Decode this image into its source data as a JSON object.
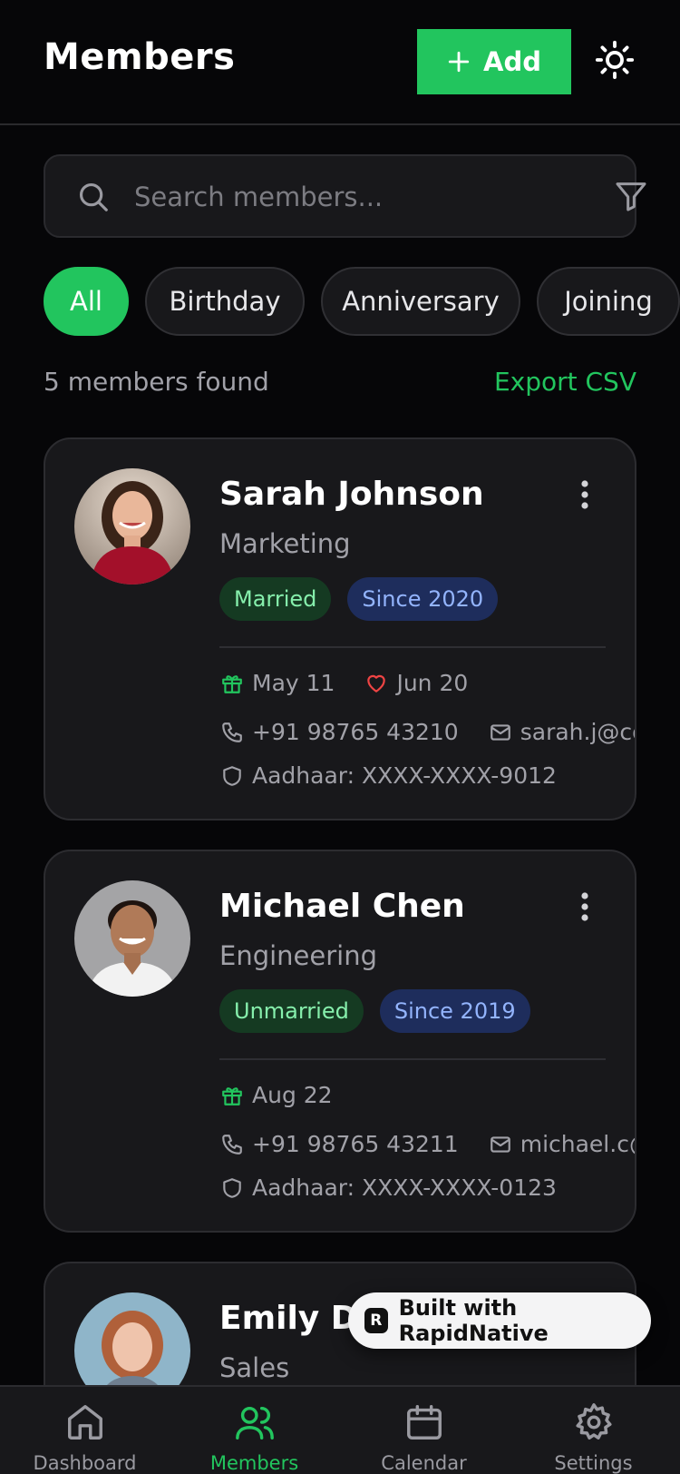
{
  "header": {
    "title": "Members",
    "add_label": "Add"
  },
  "search": {
    "placeholder": "Search members..."
  },
  "filters": [
    "All",
    "Birthday",
    "Anniversary",
    "Joining"
  ],
  "summary": {
    "count_text": "5 members found",
    "export_label": "Export CSV"
  },
  "members": [
    {
      "name": "Sarah Johnson",
      "department": "Marketing",
      "marital_status": "Married",
      "since": "Since 2020",
      "birthday": "May 11",
      "anniversary": "Jun 20",
      "phone": "+91 98765 43210",
      "email": "sarah.j@company.c",
      "aadhaar": "Aadhaar: XXXX-XXXX-9012"
    },
    {
      "name": "Michael Chen",
      "department": "Engineering",
      "marital_status": "Unmarried",
      "since": "Since 2019",
      "birthday": "Aug 22",
      "phone": "+91 98765 43211",
      "email": "michael.c@compan",
      "aadhaar": "Aadhaar: XXXX-XXXX-0123"
    },
    {
      "name": "Emily Da",
      "department": "Sales"
    }
  ],
  "badge": {
    "label": "Built with RapidNative"
  },
  "tabs": [
    {
      "label": "Dashboard",
      "icon": "home-icon"
    },
    {
      "label": "Members",
      "icon": "users-icon"
    },
    {
      "label": "Calendar",
      "icon": "calendar-icon"
    },
    {
      "label": "Settings",
      "icon": "gear-icon"
    }
  ],
  "colors": {
    "accent": "#22c55e",
    "background": "#060608",
    "card": "#18181b"
  }
}
